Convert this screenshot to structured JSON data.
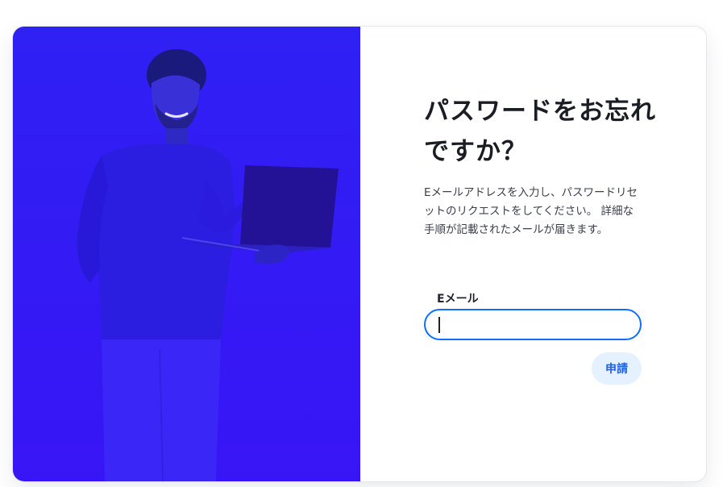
{
  "form": {
    "title": "パスワードをお忘れですか？",
    "description": "Eメールアドレスを入力し、パスワードリセットのリクエストをしてください。 詳細な手順が記載されたメールが届きます。",
    "email_label": "Eメール",
    "email_value": "",
    "submit_label": "申請"
  },
  "colors": {
    "hero_background": "#3316f4",
    "input_border": "#116dff",
    "submit_background": "#e6f1ff",
    "submit_text": "#1f5fd9"
  },
  "hero": {
    "image": "man-holding-laptop-pointing"
  }
}
